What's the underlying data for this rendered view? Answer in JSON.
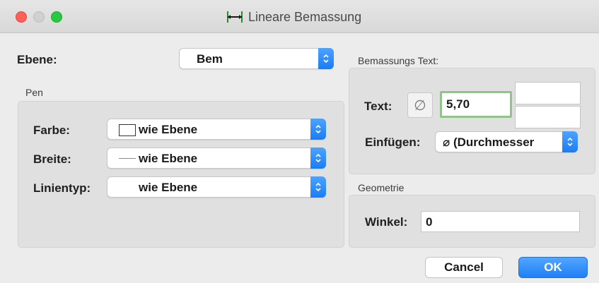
{
  "window": {
    "title": "Lineare Bemassung",
    "colors": {
      "close": "#fe5f57",
      "zoom": "#28c840",
      "accent": "#1a7cf5",
      "focus_ring": "#92c38a"
    }
  },
  "layer": {
    "label": "Ebene:",
    "value": "Bem"
  },
  "pen": {
    "title": "Pen",
    "color": {
      "label": "Farbe:",
      "value": "wie Ebene"
    },
    "width": {
      "label": "Breite:",
      "value": "wie Ebene"
    },
    "linetype": {
      "label": "Linientyp:",
      "value": "wie Ebene"
    }
  },
  "dimension_text": {
    "title": "Bemassungs Text:",
    "text_label": "Text:",
    "diameter_symbol": "∅",
    "text_value": "5,70",
    "insert_label": "Einfügen:",
    "insert_value": "⌀ (Durchmesser"
  },
  "geometry": {
    "title": "Geometrie",
    "angle_label": "Winkel:",
    "angle_value": "0"
  },
  "buttons": {
    "cancel": "Cancel",
    "ok": "OK"
  },
  "icons": [
    "close-icon",
    "minimize-icon",
    "zoom-icon",
    "dimension-icon",
    "chevron-updown-icon"
  ]
}
